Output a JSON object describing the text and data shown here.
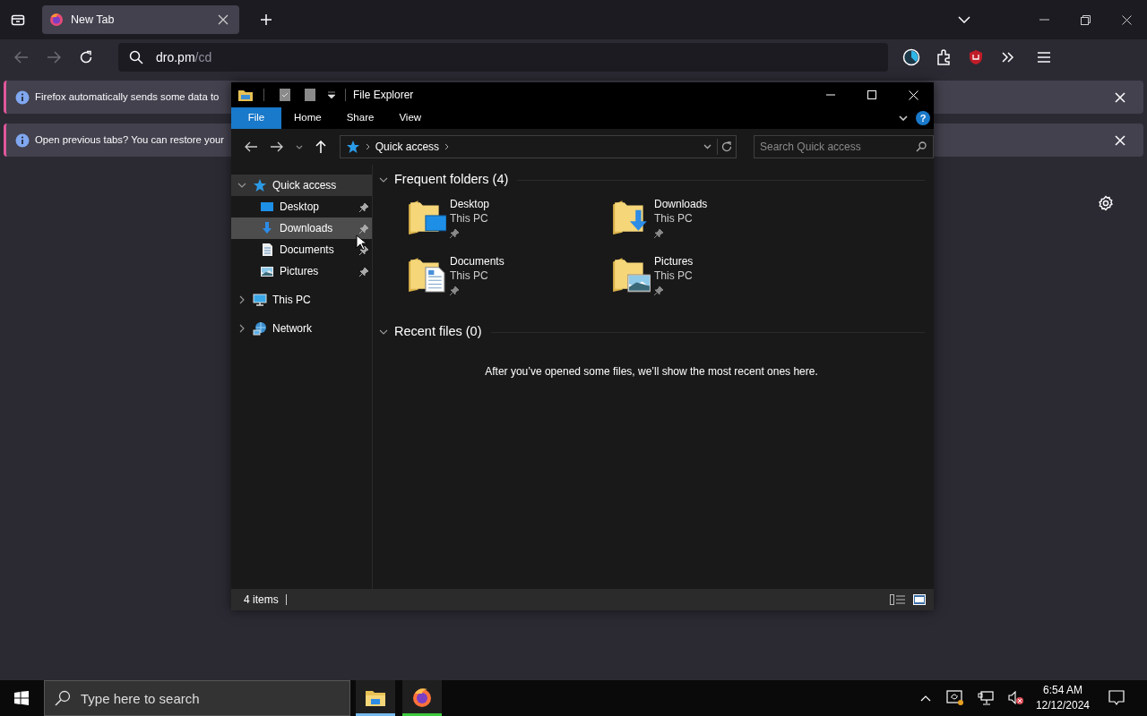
{
  "browser": {
    "tabs": [
      {
        "title": "New Tab",
        "selected": true
      }
    ],
    "back": {
      "disabled": true
    },
    "forward": {
      "disabled": true
    },
    "url": {
      "host": "dro.pm",
      "path": "/cd"
    },
    "notifications": [
      {
        "text": "Firefox automatically sends some data to"
      },
      {
        "text": "Open previous tabs? You can restore your"
      }
    ]
  },
  "explorer": {
    "title": "File Explorer",
    "ribbon_tabs": [
      {
        "label": "File",
        "selected": true
      },
      {
        "label": "Home",
        "selected": false
      },
      {
        "label": "Share",
        "selected": false
      },
      {
        "label": "View",
        "selected": false
      }
    ],
    "help_label": "?",
    "breadcrumb": [
      "Quick access"
    ],
    "search": {
      "placeholder": "Search Quick access"
    },
    "nav": [
      {
        "label": "Quick access",
        "kind": "star",
        "expanded": true,
        "selected": true,
        "hovered": false,
        "children": [
          {
            "label": "Desktop",
            "kind": "desktop",
            "pinned": true,
            "selected": false,
            "hovered": false
          },
          {
            "label": "Downloads",
            "kind": "downloads",
            "pinned": true,
            "selected": false,
            "hovered": true
          },
          {
            "label": "Documents",
            "kind": "documents",
            "pinned": true,
            "selected": false,
            "hovered": false
          },
          {
            "label": "Pictures",
            "kind": "pictures",
            "pinned": true,
            "selected": false,
            "hovered": false
          }
        ]
      },
      {
        "label": "This PC",
        "kind": "pc",
        "expanded": false,
        "selected": false,
        "hovered": false
      },
      {
        "label": "Network",
        "kind": "network",
        "expanded": false,
        "selected": false,
        "hovered": false
      }
    ],
    "sections": [
      {
        "title": "Frequent folders (4)",
        "expanded": true,
        "items": [
          {
            "name": "Desktop",
            "location": "This PC",
            "kind": "desktop",
            "pinned": true
          },
          {
            "name": "Downloads",
            "location": "This PC",
            "kind": "downloads",
            "pinned": true
          },
          {
            "name": "Documents",
            "location": "This PC",
            "kind": "documents",
            "pinned": true
          },
          {
            "name": "Pictures",
            "location": "This PC",
            "kind": "pictures",
            "pinned": true
          }
        ]
      },
      {
        "title": "Recent files (0)",
        "expanded": true,
        "empty_text": "After you’ve opened some files, we’ll show the most recent ones here."
      }
    ],
    "status": "4 items",
    "views": [
      {
        "kind": "details",
        "selected": false
      },
      {
        "kind": "large_icons",
        "selected": true
      }
    ]
  },
  "taskbar": {
    "search": {
      "placeholder": "Type here to search"
    },
    "apps": [
      {
        "kind": "explorer",
        "color": "#76b9ed"
      },
      {
        "kind": "firefox",
        "color": "#3ec93e"
      }
    ],
    "time": "6:54 AM",
    "date": "12/12/2024"
  }
}
